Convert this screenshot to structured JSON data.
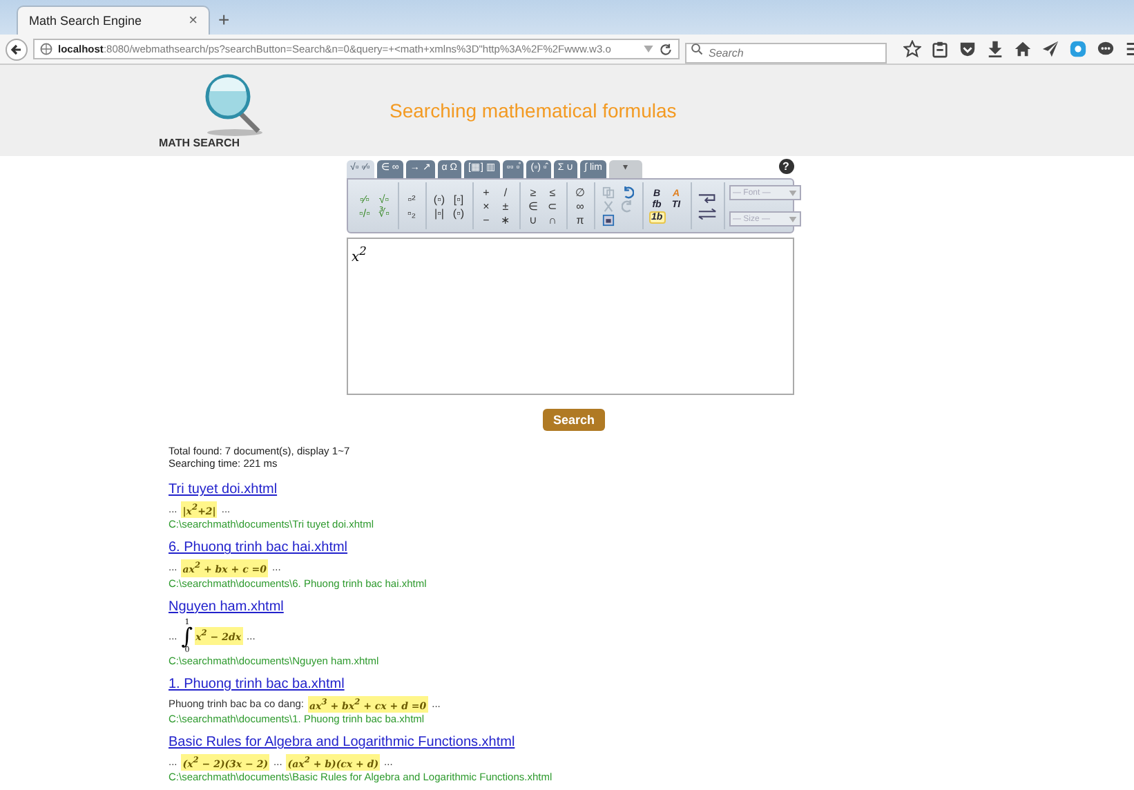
{
  "browser": {
    "tab_title": "Math Search Engine",
    "tab_close": "×",
    "new_tab": "+",
    "url_host": "localhost",
    "url_rest": ":8080/webmathsearch/ps?searchButton=Search&n=0&query=+<math+xmlns%3D\"http%3A%2F%2Fwww.w3.o",
    "search_placeholder": "Search"
  },
  "header": {
    "logo_text": "MATH SEARCH",
    "tagline": "Searching mathematical formulas"
  },
  "editor": {
    "tabs": [
      {
        "label": "√▫ ▫⁄▫",
        "selected": true,
        "disabled": false
      },
      {
        "label": "∈ ∞",
        "selected": false,
        "disabled": false
      },
      {
        "label": "→ ↗",
        "selected": false,
        "disabled": false
      },
      {
        "label": "α Ω",
        "selected": false,
        "disabled": false
      },
      {
        "label": "[▦] ▥",
        "selected": false,
        "disabled": false
      },
      {
        "label": "▫▫ ▫̊",
        "selected": false,
        "disabled": false
      },
      {
        "label": "(▫) ▫̂",
        "selected": false,
        "disabled": false
      },
      {
        "label": "Σ ∪",
        "selected": false,
        "disabled": false
      },
      {
        "label": "∫ lim",
        "selected": false,
        "disabled": false
      },
      {
        "label": "▾",
        "selected": false,
        "disabled": true
      }
    ],
    "help": "?",
    "groups": [
      {
        "rows": [
          [
            "▫⁄▫",
            "√▫"
          ],
          [
            "▫/▫",
            "∛▫"
          ]
        ]
      },
      {
        "rows": [
          [
            "▫²"
          ],
          [
            "▫₂"
          ]
        ]
      },
      {
        "rows": [
          [
            "(▫)",
            "[▫]"
          ],
          [
            "|▫|",
            "(▫)"
          ]
        ]
      },
      {
        "rows": [
          [
            "+",
            "/"
          ],
          [
            "×",
            "±"
          ],
          [
            "−",
            "∗"
          ]
        ]
      },
      {
        "rows": [
          [
            "≥",
            "≤"
          ],
          [
            "∈",
            "⊂"
          ],
          [
            "∪",
            "∩"
          ]
        ]
      },
      {
        "rows": [
          [
            "∅"
          ],
          [
            "∞"
          ],
          [
            "π"
          ]
        ]
      }
    ],
    "edit_tools": [
      {
        "kind": "copy",
        "disabled": true
      },
      {
        "kind": "undo",
        "disabled": false
      },
      {
        "kind": "cut",
        "disabled": true
      },
      {
        "kind": "redo",
        "disabled": true
      },
      {
        "kind": "frame",
        "disabled": false
      }
    ],
    "format_tools": [
      {
        "label": "B",
        "selected": false
      },
      {
        "label": "A",
        "selected": false
      },
      {
        "label": "fb",
        "selected": false
      },
      {
        "label": "TI",
        "selected": false
      },
      {
        "label": "1b",
        "selected": true
      }
    ],
    "selects": [
      {
        "placeholder": "— Font —"
      },
      {
        "placeholder": "— Size —"
      }
    ],
    "input": "x$^{2}$"
  },
  "search_button": "Search",
  "summary": [
    "Total found: 7 document(s), display 1~7",
    "Searching time: 221 ms"
  ],
  "results": [
    {
      "title": "Tri tuyet doi.xhtml",
      "snippet": [
        {
          "kind": "text",
          "text": "..."
        },
        {
          "kind": "formula",
          "text": "|x$^{2}$+2|"
        },
        {
          "kind": "text",
          "text": "..."
        }
      ],
      "path": "C:\\searchmath\\documents\\Tri tuyet doi.xhtml"
    },
    {
      "title": "6. Phuong trinh bac hai.xhtml",
      "snippet": [
        {
          "kind": "text",
          "text": "..."
        },
        {
          "kind": "formula",
          "text": "ax$^{2}$ + bx + c =0"
        },
        {
          "kind": "text",
          "text": "..."
        }
      ],
      "path": "C:\\searchmath\\documents\\6. Phuong trinh bac hai.xhtml"
    },
    {
      "title": "Nguyen ham.xhtml",
      "snippet": [
        {
          "kind": "text",
          "text": "..."
        },
        {
          "kind": "integral",
          "upper": "1",
          "sign": "∫",
          "lower": "0",
          "text": "x$^{2}$ − 2dx"
        },
        {
          "kind": "text",
          "text": "..."
        }
      ],
      "path": "C:\\searchmath\\documents\\Nguyen ham.xhtml"
    },
    {
      "title": "1. Phuong trinh bac ba.xhtml",
      "snippet": [
        {
          "kind": "text",
          "text": "Phuong trinh bac ba co dang:"
        },
        {
          "kind": "formula",
          "text": "ax$^{3}$ + bx$^{2}$ + cx + d =0"
        },
        {
          "kind": "text",
          "text": "..."
        }
      ],
      "path": "C:\\searchmath\\documents\\1. Phuong trinh bac ba.xhtml"
    },
    {
      "title": "Basic Rules for Algebra and Logarithmic Functions.xhtml",
      "snippet": [
        {
          "kind": "text",
          "text": "..."
        },
        {
          "kind": "formula",
          "text": "(x$^{2}$ − 2)(3x − 2)"
        },
        {
          "kind": "text",
          "text": "..."
        },
        {
          "kind": "formula",
          "text": "(ax$^{2}$ + b)(cx + d)"
        },
        {
          "kind": "text",
          "text": "..."
        }
      ],
      "path": "C:\\searchmath\\documents\\Basic Rules for Algebra and Logarithmic Functions.xhtml"
    }
  ]
}
